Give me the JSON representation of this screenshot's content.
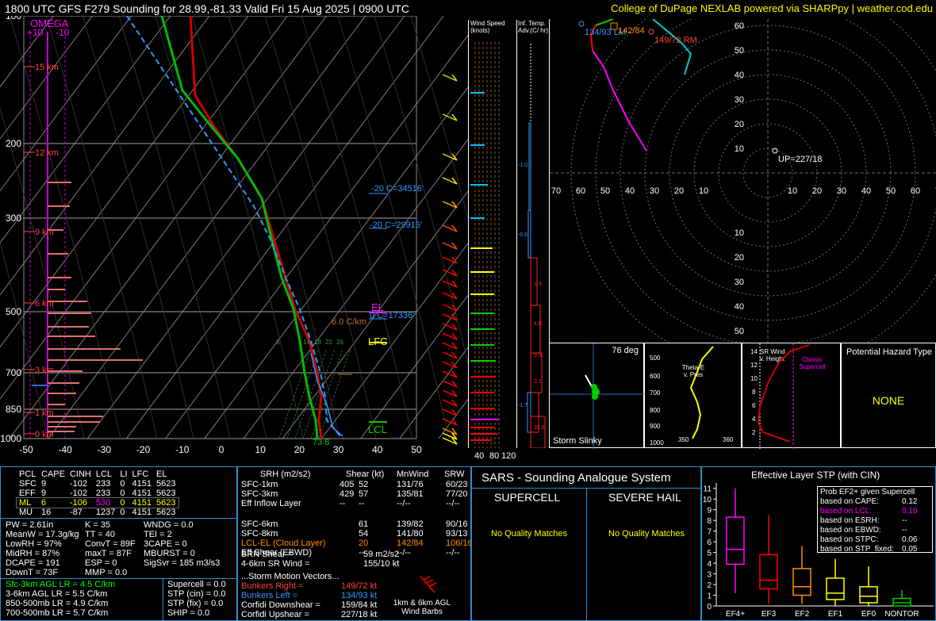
{
  "header": {
    "title": "1800 UTC GFS F279 Sounding for 28.99,-81.33 Valid  Fri 15 Aug 2025 | 0900 UTC",
    "credit": "College of DuPage NEXLAB powered via SHARPpy | weather.cod.edu"
  },
  "skewt": {
    "omega_label": "OMEGA",
    "omega_ticks": [
      "+10",
      "-10"
    ],
    "pressure_ticks": [
      "100",
      "200",
      "300",
      "500",
      "700",
      "850",
      "1000"
    ],
    "temp_ticks": [
      "-50",
      "-40",
      "-30",
      "-20",
      "-10",
      "0",
      "10",
      "20",
      "30",
      "40",
      "50"
    ],
    "height_labels": [
      "15 km",
      "12 km",
      "9 km",
      "6 km",
      "3 km",
      "1 km",
      "0 km"
    ],
    "dcz_labels": [
      "-20 C=34516'",
      "-20 C=29915'",
      "0 C=17336'"
    ],
    "el_label": "EL",
    "lfc_label": "LFC",
    "lcl_label": "LCL",
    "lapse_label": "6.0 C/km",
    "mix_labels": [
      "6",
      "14",
      "18",
      "22",
      "26"
    ],
    "sfc_label": "73 8",
    "colors": {
      "temp": "#cc0000",
      "dewpoint": "#00bb00",
      "virtual": "#3399ff",
      "parcel": "#3399ff",
      "grid": "#808080"
    }
  },
  "wind_panel": {
    "speed_title": "Wind Speed (knots)",
    "speed_ticks": [
      "40",
      "80",
      "120"
    ],
    "adv_title": "Inf. Temp. Adv.(C/ hr)",
    "adv_values": [
      "-1.0",
      "-0.6",
      "1.9",
      "4.8",
      "9.8",
      "2.1",
      "-1.7",
      "32.8"
    ]
  },
  "hodo": {
    "ring_labels": [
      "70",
      "60",
      "50",
      "40",
      "30",
      "20",
      "10"
    ],
    "x_labels": [
      "70",
      "60",
      "50",
      "40",
      "30",
      "20",
      "10",
      "10",
      "20",
      "30",
      "40",
      "50",
      "60",
      "70"
    ],
    "y_labels_top": [
      "60",
      "50",
      "40",
      "30",
      "20",
      "10"
    ],
    "y_labels_bottom": [
      "10",
      "20",
      "30",
      "40",
      "50",
      "60"
    ],
    "labels": {
      "lm": "134/93 LM",
      "mean": "142/84",
      "rm": "149/72 RM",
      "up": "UP=227/18"
    }
  },
  "slinky": {
    "deg": "76 deg",
    "title": "Storm Slinky"
  },
  "theta": {
    "title": "Theta-E v. Pres",
    "pres": [
      "500",
      "600",
      "700",
      "800",
      "900",
      "1000"
    ],
    "x": [
      "350",
      "360"
    ]
  },
  "srwind": {
    "title": "SR Wind v. Height",
    "classic": "Classic Supercell",
    "heights": [
      "14",
      "12",
      "10",
      "8",
      "6",
      "4",
      "2"
    ]
  },
  "hazard": {
    "title": "Potential Hazard Type",
    "value": "NONE"
  },
  "indices": {
    "headers": [
      "PCL",
      "CAPE",
      "CINH",
      "LCL",
      "LI",
      "LFC",
      "EL"
    ],
    "rows": [
      [
        "SFC",
        "9",
        "-102",
        "233",
        "0",
        "4151",
        "5623"
      ],
      [
        "EFF",
        "9",
        "-102",
        "233",
        "0",
        "4151",
        "5623"
      ],
      [
        "ML",
        "6",
        "-106",
        "530",
        "0",
        "4151",
        "5623"
      ],
      [
        "MU",
        "16",
        "-87",
        "1237",
        "0",
        "4151",
        "5623"
      ]
    ],
    "col1": [
      "PW = 2.61in",
      "MeanW = 17.3g/kg",
      "LowRH = 97%",
      "MidRH = 87%",
      "DCAPE = 191",
      "DownT = 73F"
    ],
    "col2": [
      "K = 35",
      "TT = 40",
      "ConvT = 89F",
      "maxT = 87F",
      "ESP = 0",
      "MMP = 0.0"
    ],
    "col3": [
      "WNDG = 0.0",
      "TEI = 2",
      "3CAPE = 0",
      "MBURST = 0",
      "",
      "SigSvr = 185 m3/s3"
    ],
    "lapse": [
      "Sfc-3km AGL LR = 4.5 C/km",
      "3-6km AGL LR = 5.5 C/km",
      "850-500mb LR = 4.9 C/km",
      "700-500mb LR = 5.7 C/km"
    ],
    "comp": [
      "Supercell = 0.0",
      "STP (cin) = 0.0",
      "STP (fix) = 0.0",
      "SHIP = 0.0"
    ]
  },
  "kinematics": {
    "headers": [
      "SRH (m2/s2)",
      "Shear (kt)",
      "MnWind",
      "SRW"
    ],
    "rows": [
      [
        "SFC-1km",
        "405",
        "52",
        "131/76",
        "60/23"
      ],
      [
        "SFC-3km",
        "429",
        "57",
        "135/81",
        "77/20"
      ],
      [
        "Eff Inflow Layer",
        "--",
        "--",
        "--/--",
        "--/--"
      ],
      [
        "",
        "",
        "",
        "",
        ""
      ],
      [
        "SFC-6km",
        "",
        "61",
        "139/82",
        "90/16"
      ],
      [
        "SFC-8km",
        "",
        "54",
        "141/80",
        "93/13"
      ],
      [
        "LCL-EL (Cloud Layer)",
        "",
        "20",
        "142/84",
        "106/16"
      ],
      [
        "Eff Shear (EBWD)",
        "",
        "--",
        "--/--",
        "--/--"
      ]
    ],
    "brn": [
      "BRN Shear =",
      "59 m2/s2"
    ],
    "sr46": [
      "4-6km SR Wind =",
      "155/10 kt"
    ],
    "storm_title": "...Storm Motion Vectors...",
    "storm": [
      [
        "Bunkers Right =",
        "149/72 kt"
      ],
      [
        "Bunkers Left =",
        "134/93 kt"
      ],
      [
        "Corfidi Downshear =",
        "159/84 kt"
      ],
      [
        "Corfidi Upshear =",
        "227/18 kt"
      ]
    ],
    "barbs_label": "1km & 6km AGL Wind Barbs"
  },
  "sars": {
    "title": "SARS - Sounding Analogue System",
    "supercell": "SUPERCELL",
    "hail": "SEVERE HAIL",
    "no_match": "No Quality Matches"
  },
  "stp": {
    "title": "Effective Layer STP (with CIN)",
    "prob_title": "Prob EF2+ given Supercell",
    "probs": [
      [
        "based on CAPE:",
        "0.12"
      ],
      [
        "based on LCL:",
        "0.19"
      ],
      [
        "based on ESRH:",
        "--"
      ],
      [
        "based on EBWD:",
        "--"
      ],
      [
        "based on STPC:",
        "0.06"
      ],
      [
        "based on STP_fixed:",
        "0.05"
      ]
    ],
    "y_ticks": [
      "0",
      "1",
      "2",
      "3",
      "4",
      "5",
      "6",
      "7",
      "8",
      "9",
      "10",
      "11"
    ]
  },
  "chart_data": {
    "type": "box",
    "categories": [
      "EF4+",
      "EF3",
      "EF2",
      "EF1",
      "EF0",
      "NONTOR"
    ],
    "boxes": [
      {
        "whisker_low": 1.2,
        "q1": 3.9,
        "median": 5.3,
        "q3": 8.3,
        "whisker_high": 11.0,
        "color": "#ff00ff"
      },
      {
        "whisker_low": 0.2,
        "q1": 1.6,
        "median": 2.4,
        "q3": 4.8,
        "whisker_high": 8.5,
        "color": "#ff0000"
      },
      {
        "whisker_low": 0.2,
        "q1": 1.0,
        "median": 1.8,
        "q3": 3.5,
        "whisker_high": 5.6,
        "color": "#ff8c00"
      },
      {
        "whisker_low": 0.0,
        "q1": 0.6,
        "median": 1.2,
        "q3": 2.6,
        "whisker_high": 4.4,
        "color": "#ffff00"
      },
      {
        "whisker_low": 0.0,
        "q1": 0.3,
        "median": 0.9,
        "q3": 1.8,
        "whisker_high": 3.7,
        "color": "#ffff00"
      },
      {
        "whisker_low": 0.0,
        "q1": 0.0,
        "median": 0.3,
        "q3": 0.7,
        "whisker_high": 1.5,
        "color": "#00cc00"
      }
    ],
    "ylim": [
      0,
      11.5
    ]
  }
}
